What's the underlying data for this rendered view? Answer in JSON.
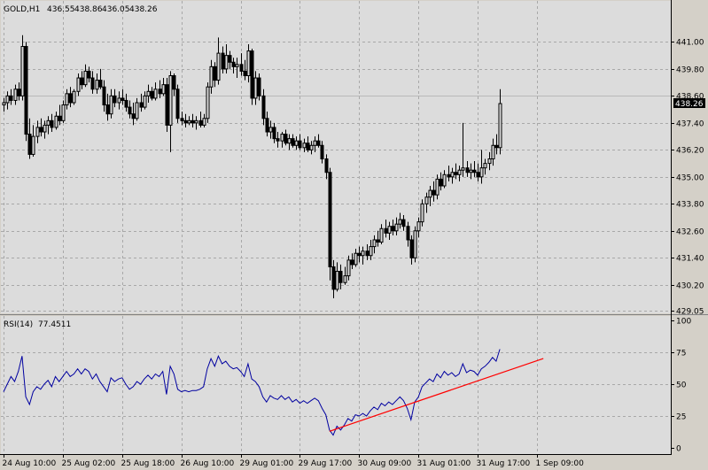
{
  "chart_data": [
    {
      "type": "candlestick",
      "symbol": "GOLD,H1",
      "ohlc_readout": [
        "436.55",
        "438.86",
        "436.05",
        "438.26"
      ],
      "current_price": 438.26,
      "current_price_label": "438.26",
      "reference_line": 438.6,
      "ylim": [
        429.05,
        442.2
      ],
      "y_ticks": [
        "441.00",
        "439.80",
        "438.60",
        "437.40",
        "436.20",
        "435.00",
        "433.80",
        "432.60",
        "431.40",
        "430.20",
        "429.05"
      ],
      "time_ticks": [
        "24 Aug 10:00",
        "25 Aug 02:00",
        "25 Aug 18:00",
        "26 Aug 10:00",
        "29 Aug 01:00",
        "29 Aug 17:00",
        "30 Aug 09:00",
        "31 Aug 01:00",
        "31 Aug 17:00",
        "1 Sep 09:00"
      ],
      "bars_per_tick": 16,
      "candles": [
        [
          438.2,
          438.5,
          437.9,
          438.3
        ],
        [
          438.3,
          438.8,
          438.0,
          438.6
        ],
        [
          438.6,
          438.9,
          438.2,
          438.4
        ],
        [
          438.4,
          439.1,
          438.2,
          438.9
        ],
        [
          438.9,
          439.2,
          438.4,
          438.6
        ],
        [
          438.6,
          441.3,
          438.4,
          440.8
        ],
        [
          440.8,
          441.0,
          436.6,
          436.9
        ],
        [
          436.9,
          437.6,
          435.8,
          436.0
        ],
        [
          436.0,
          437.3,
          435.9,
          436.8
        ],
        [
          436.8,
          437.5,
          436.5,
          437.2
        ],
        [
          437.2,
          437.6,
          436.8,
          437.0
        ],
        [
          437.0,
          437.5,
          436.7,
          437.3
        ],
        [
          437.3,
          437.7,
          436.9,
          437.5
        ],
        [
          437.5,
          437.8,
          437.0,
          437.2
        ],
        [
          437.2,
          437.9,
          437.1,
          437.7
        ],
        [
          437.7,
          438.2,
          437.3,
          437.5
        ],
        [
          437.5,
          438.4,
          437.4,
          438.2
        ],
        [
          438.2,
          438.9,
          438.0,
          438.7
        ],
        [
          438.7,
          439.0,
          438.1,
          438.3
        ],
        [
          438.3,
          438.9,
          438.2,
          438.8
        ],
        [
          438.8,
          439.6,
          438.6,
          439.4
        ],
        [
          439.4,
          439.7,
          438.9,
          439.1
        ],
        [
          439.1,
          440.0,
          439.0,
          439.7
        ],
        [
          439.7,
          439.9,
          439.2,
          439.4
        ],
        [
          439.4,
          439.7,
          438.7,
          438.9
        ],
        [
          438.9,
          439.6,
          438.7,
          439.3
        ],
        [
          439.3,
          439.8,
          438.9,
          439.0
        ],
        [
          439.0,
          439.3,
          437.9,
          438.2
        ],
        [
          438.2,
          438.7,
          437.5,
          437.8
        ],
        [
          437.8,
          438.9,
          437.6,
          438.6
        ],
        [
          438.6,
          438.9,
          438.1,
          438.3
        ],
        [
          438.3,
          438.8,
          438.0,
          438.5
        ],
        [
          438.5,
          438.9,
          438.2,
          438.4
        ],
        [
          438.4,
          438.7,
          437.9,
          438.1
        ],
        [
          438.1,
          438.4,
          437.6,
          437.8
        ],
        [
          437.8,
          438.3,
          437.3,
          437.6
        ],
        [
          437.6,
          438.5,
          437.5,
          438.3
        ],
        [
          438.3,
          438.7,
          437.9,
          438.1
        ],
        [
          438.1,
          438.8,
          438.0,
          438.6
        ],
        [
          438.6,
          439.1,
          438.3,
          438.8
        ],
        [
          438.8,
          439.0,
          438.4,
          438.5
        ],
        [
          438.5,
          439.2,
          438.4,
          438.9
        ],
        [
          438.9,
          439.3,
          438.5,
          438.7
        ],
        [
          438.7,
          439.4,
          438.6,
          439.1
        ],
        [
          439.1,
          439.4,
          437.0,
          437.3
        ],
        [
          437.3,
          439.7,
          436.1,
          439.5
        ],
        [
          439.5,
          439.6,
          438.6,
          438.9
        ],
        [
          438.9,
          439.1,
          437.4,
          437.6
        ],
        [
          437.6,
          437.9,
          437.3,
          437.5
        ],
        [
          437.5,
          437.8,
          437.2,
          437.4
        ],
        [
          437.4,
          437.7,
          437.3,
          437.5
        ],
        [
          437.5,
          437.8,
          437.2,
          437.4
        ],
        [
          437.4,
          437.7,
          437.1,
          437.5
        ],
        [
          437.5,
          437.9,
          437.2,
          437.3
        ],
        [
          437.3,
          437.8,
          437.2,
          437.6
        ],
        [
          437.6,
          439.2,
          437.4,
          439.0
        ],
        [
          439.0,
          440.2,
          438.7,
          439.9
        ],
        [
          439.9,
          440.1,
          439.0,
          439.3
        ],
        [
          439.3,
          441.2,
          439.1,
          440.5
        ],
        [
          440.5,
          440.8,
          439.6,
          439.8
        ],
        [
          439.8,
          440.9,
          439.6,
          440.4
        ],
        [
          440.4,
          440.6,
          439.8,
          440.1
        ],
        [
          440.1,
          440.3,
          439.6,
          439.9
        ],
        [
          439.9,
          440.3,
          439.4,
          440.0
        ],
        [
          440.0,
          440.5,
          439.5,
          439.7
        ],
        [
          439.7,
          440.2,
          439.3,
          439.5
        ],
        [
          439.5,
          440.9,
          439.2,
          440.6
        ],
        [
          440.6,
          440.7,
          438.2,
          438.5
        ],
        [
          438.5,
          439.7,
          438.2,
          439.4
        ],
        [
          439.4,
          439.6,
          438.4,
          438.6
        ],
        [
          438.6,
          438.9,
          437.3,
          437.6
        ],
        [
          437.6,
          437.9,
          436.8,
          437.0
        ],
        [
          437.0,
          437.5,
          436.7,
          437.2
        ],
        [
          437.2,
          437.4,
          436.5,
          436.7
        ],
        [
          436.7,
          437.0,
          436.3,
          436.6
        ],
        [
          436.6,
          437.0,
          436.3,
          436.9
        ],
        [
          436.9,
          437.1,
          436.4,
          436.5
        ],
        [
          436.5,
          436.9,
          436.2,
          436.7
        ],
        [
          436.7,
          436.9,
          436.3,
          436.4
        ],
        [
          436.4,
          436.8,
          436.2,
          436.6
        ],
        [
          436.6,
          436.9,
          436.2,
          436.3
        ],
        [
          436.3,
          436.7,
          436.1,
          436.5
        ],
        [
          436.5,
          436.8,
          436.1,
          436.2
        ],
        [
          436.2,
          436.6,
          436.0,
          436.4
        ],
        [
          436.4,
          436.8,
          436.1,
          436.6
        ],
        [
          436.6,
          436.9,
          436.3,
          436.4
        ],
        [
          436.4,
          436.6,
          435.6,
          435.8
        ],
        [
          435.8,
          436.0,
          434.9,
          435.2
        ],
        [
          435.2,
          435.4,
          430.4,
          431.0
        ],
        [
          431.0,
          431.3,
          429.6,
          430.0
        ],
        [
          430.0,
          431.2,
          429.9,
          430.8
        ],
        [
          430.8,
          431.1,
          430.0,
          430.3
        ],
        [
          430.3,
          431.0,
          430.2,
          430.6
        ],
        [
          430.6,
          431.5,
          430.4,
          431.3
        ],
        [
          431.3,
          431.6,
          430.9,
          431.1
        ],
        [
          431.1,
          431.8,
          431.0,
          431.6
        ],
        [
          431.6,
          431.9,
          431.2,
          431.5
        ],
        [
          431.5,
          431.9,
          431.1,
          431.7
        ],
        [
          431.7,
          432.0,
          431.3,
          431.5
        ],
        [
          431.5,
          432.2,
          431.3,
          431.9
        ],
        [
          431.9,
          432.4,
          431.6,
          432.2
        ],
        [
          432.2,
          432.6,
          431.9,
          432.1
        ],
        [
          432.1,
          432.9,
          432.0,
          432.7
        ],
        [
          432.7,
          433.1,
          432.3,
          432.5
        ],
        [
          432.5,
          433.0,
          432.2,
          432.8
        ],
        [
          432.8,
          433.1,
          432.4,
          432.6
        ],
        [
          432.6,
          433.2,
          432.4,
          432.9
        ],
        [
          432.9,
          433.4,
          432.7,
          433.1
        ],
        [
          433.1,
          433.3,
          432.6,
          432.8
        ],
        [
          432.8,
          433.0,
          431.9,
          432.2
        ],
        [
          432.2,
          432.4,
          431.1,
          431.4
        ],
        [
          431.4,
          432.8,
          431.2,
          432.6
        ],
        [
          432.6,
          433.2,
          432.3,
          433.0
        ],
        [
          433.0,
          434.0,
          432.8,
          433.8
        ],
        [
          433.8,
          434.3,
          433.4,
          434.1
        ],
        [
          434.1,
          434.6,
          433.7,
          434.4
        ],
        [
          434.4,
          434.8,
          433.9,
          434.2
        ],
        [
          434.2,
          435.1,
          434.0,
          434.9
        ],
        [
          434.9,
          435.2,
          434.4,
          434.6
        ],
        [
          434.6,
          435.3,
          434.5,
          435.1
        ],
        [
          435.1,
          435.5,
          434.8,
          435.0
        ],
        [
          435.0,
          435.4,
          434.7,
          435.2
        ],
        [
          435.2,
          435.6,
          434.9,
          435.1
        ],
        [
          435.1,
          435.5,
          434.8,
          435.3
        ],
        [
          435.3,
          437.4,
          435.0,
          435.4
        ],
        [
          435.4,
          435.7,
          435.0,
          435.2
        ],
        [
          435.2,
          435.6,
          434.9,
          435.3
        ],
        [
          435.3,
          435.7,
          435.0,
          435.2
        ],
        [
          435.2,
          435.6,
          434.8,
          435.0
        ],
        [
          435.0,
          436.2,
          434.7,
          435.4
        ],
        [
          435.4,
          435.8,
          435.1,
          435.6
        ],
        [
          435.6,
          436.1,
          435.3,
          435.8
        ],
        [
          435.8,
          436.7,
          435.5,
          436.4
        ],
        [
          436.4,
          436.9,
          436.0,
          436.3
        ],
        [
          436.3,
          438.9,
          436.0,
          438.26
        ]
      ]
    },
    {
      "type": "line",
      "title": "RSI(14)",
      "value_label": "77.4511",
      "ylim": [
        0,
        100
      ],
      "y_ticks": [
        "100",
        "75",
        "50",
        "25",
        "0"
      ],
      "series": [
        {
          "values": [
            44,
            50,
            56,
            52,
            60,
            72,
            40,
            34,
            44,
            48,
            46,
            50,
            53,
            48,
            56,
            52,
            56,
            60,
            56,
            58,
            62,
            58,
            62,
            60,
            54,
            58,
            52,
            48,
            44,
            55,
            52,
            54,
            55,
            50,
            46,
            48,
            52,
            50,
            54,
            57,
            54,
            58,
            56,
            60,
            42,
            64,
            58,
            46,
            44,
            45,
            44,
            45,
            45,
            46,
            48,
            62,
            70,
            64,
            72,
            66,
            68,
            64,
            62,
            63,
            60,
            56,
            66,
            54,
            52,
            48,
            40,
            36,
            41,
            39,
            38,
            41,
            38,
            40,
            36,
            38,
            35,
            37,
            35,
            37,
            39,
            37,
            31,
            26,
            14,
            10,
            17,
            14,
            18,
            23,
            21,
            26,
            25,
            27,
            25,
            29,
            32,
            30,
            35,
            33,
            36,
            34,
            37,
            40,
            37,
            31,
            22,
            36,
            40,
            48,
            51,
            54,
            52,
            58,
            55,
            60,
            57,
            59,
            56,
            58,
            66,
            59,
            61,
            60,
            57,
            62,
            64,
            67,
            71,
            68,
            77.45
          ]
        }
      ],
      "trendline": {
        "from": [
          88,
          13
        ],
        "to": [
          140,
          68
        ]
      },
      "trendline_color": "#ff0000",
      "line_color": "#0000a0"
    }
  ],
  "colors": {
    "background": "#d4d0c8",
    "panel": "#dcdcdc",
    "grid": "#a8a8a8",
    "candle": "#000000",
    "price_tag_bg": "#000000",
    "price_tag_fg": "#ffffff"
  }
}
